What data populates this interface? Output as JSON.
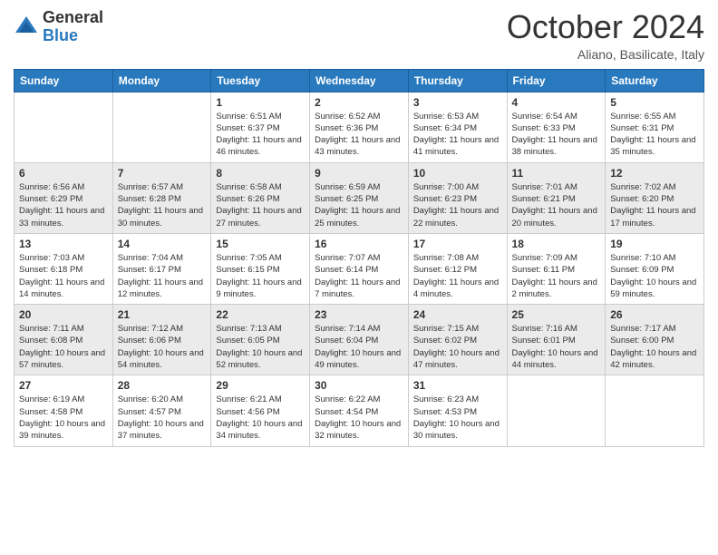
{
  "logo": {
    "general": "General",
    "blue": "Blue"
  },
  "header": {
    "title": "October 2024",
    "subtitle": "Aliano, Basilicate, Italy"
  },
  "weekdays": [
    "Sunday",
    "Monday",
    "Tuesday",
    "Wednesday",
    "Thursday",
    "Friday",
    "Saturday"
  ],
  "weeks": [
    {
      "row_class": "row-odd",
      "days": [
        {
          "num": "",
          "info": ""
        },
        {
          "num": "",
          "info": ""
        },
        {
          "num": "1",
          "info": "Sunrise: 6:51 AM\nSunset: 6:37 PM\nDaylight: 11 hours and 46 minutes."
        },
        {
          "num": "2",
          "info": "Sunrise: 6:52 AM\nSunset: 6:36 PM\nDaylight: 11 hours and 43 minutes."
        },
        {
          "num": "3",
          "info": "Sunrise: 6:53 AM\nSunset: 6:34 PM\nDaylight: 11 hours and 41 minutes."
        },
        {
          "num": "4",
          "info": "Sunrise: 6:54 AM\nSunset: 6:33 PM\nDaylight: 11 hours and 38 minutes."
        },
        {
          "num": "5",
          "info": "Sunrise: 6:55 AM\nSunset: 6:31 PM\nDaylight: 11 hours and 35 minutes."
        }
      ]
    },
    {
      "row_class": "row-even",
      "days": [
        {
          "num": "6",
          "info": "Sunrise: 6:56 AM\nSunset: 6:29 PM\nDaylight: 11 hours and 33 minutes."
        },
        {
          "num": "7",
          "info": "Sunrise: 6:57 AM\nSunset: 6:28 PM\nDaylight: 11 hours and 30 minutes."
        },
        {
          "num": "8",
          "info": "Sunrise: 6:58 AM\nSunset: 6:26 PM\nDaylight: 11 hours and 27 minutes."
        },
        {
          "num": "9",
          "info": "Sunrise: 6:59 AM\nSunset: 6:25 PM\nDaylight: 11 hours and 25 minutes."
        },
        {
          "num": "10",
          "info": "Sunrise: 7:00 AM\nSunset: 6:23 PM\nDaylight: 11 hours and 22 minutes."
        },
        {
          "num": "11",
          "info": "Sunrise: 7:01 AM\nSunset: 6:21 PM\nDaylight: 11 hours and 20 minutes."
        },
        {
          "num": "12",
          "info": "Sunrise: 7:02 AM\nSunset: 6:20 PM\nDaylight: 11 hours and 17 minutes."
        }
      ]
    },
    {
      "row_class": "row-odd",
      "days": [
        {
          "num": "13",
          "info": "Sunrise: 7:03 AM\nSunset: 6:18 PM\nDaylight: 11 hours and 14 minutes."
        },
        {
          "num": "14",
          "info": "Sunrise: 7:04 AM\nSunset: 6:17 PM\nDaylight: 11 hours and 12 minutes."
        },
        {
          "num": "15",
          "info": "Sunrise: 7:05 AM\nSunset: 6:15 PM\nDaylight: 11 hours and 9 minutes."
        },
        {
          "num": "16",
          "info": "Sunrise: 7:07 AM\nSunset: 6:14 PM\nDaylight: 11 hours and 7 minutes."
        },
        {
          "num": "17",
          "info": "Sunrise: 7:08 AM\nSunset: 6:12 PM\nDaylight: 11 hours and 4 minutes."
        },
        {
          "num": "18",
          "info": "Sunrise: 7:09 AM\nSunset: 6:11 PM\nDaylight: 11 hours and 2 minutes."
        },
        {
          "num": "19",
          "info": "Sunrise: 7:10 AM\nSunset: 6:09 PM\nDaylight: 10 hours and 59 minutes."
        }
      ]
    },
    {
      "row_class": "row-even",
      "days": [
        {
          "num": "20",
          "info": "Sunrise: 7:11 AM\nSunset: 6:08 PM\nDaylight: 10 hours and 57 minutes."
        },
        {
          "num": "21",
          "info": "Sunrise: 7:12 AM\nSunset: 6:06 PM\nDaylight: 10 hours and 54 minutes."
        },
        {
          "num": "22",
          "info": "Sunrise: 7:13 AM\nSunset: 6:05 PM\nDaylight: 10 hours and 52 minutes."
        },
        {
          "num": "23",
          "info": "Sunrise: 7:14 AM\nSunset: 6:04 PM\nDaylight: 10 hours and 49 minutes."
        },
        {
          "num": "24",
          "info": "Sunrise: 7:15 AM\nSunset: 6:02 PM\nDaylight: 10 hours and 47 minutes."
        },
        {
          "num": "25",
          "info": "Sunrise: 7:16 AM\nSunset: 6:01 PM\nDaylight: 10 hours and 44 minutes."
        },
        {
          "num": "26",
          "info": "Sunrise: 7:17 AM\nSunset: 6:00 PM\nDaylight: 10 hours and 42 minutes."
        }
      ]
    },
    {
      "row_class": "row-odd",
      "days": [
        {
          "num": "27",
          "info": "Sunrise: 6:19 AM\nSunset: 4:58 PM\nDaylight: 10 hours and 39 minutes."
        },
        {
          "num": "28",
          "info": "Sunrise: 6:20 AM\nSunset: 4:57 PM\nDaylight: 10 hours and 37 minutes."
        },
        {
          "num": "29",
          "info": "Sunrise: 6:21 AM\nSunset: 4:56 PM\nDaylight: 10 hours and 34 minutes."
        },
        {
          "num": "30",
          "info": "Sunrise: 6:22 AM\nSunset: 4:54 PM\nDaylight: 10 hours and 32 minutes."
        },
        {
          "num": "31",
          "info": "Sunrise: 6:23 AM\nSunset: 4:53 PM\nDaylight: 10 hours and 30 minutes."
        },
        {
          "num": "",
          "info": ""
        },
        {
          "num": "",
          "info": ""
        }
      ]
    }
  ]
}
